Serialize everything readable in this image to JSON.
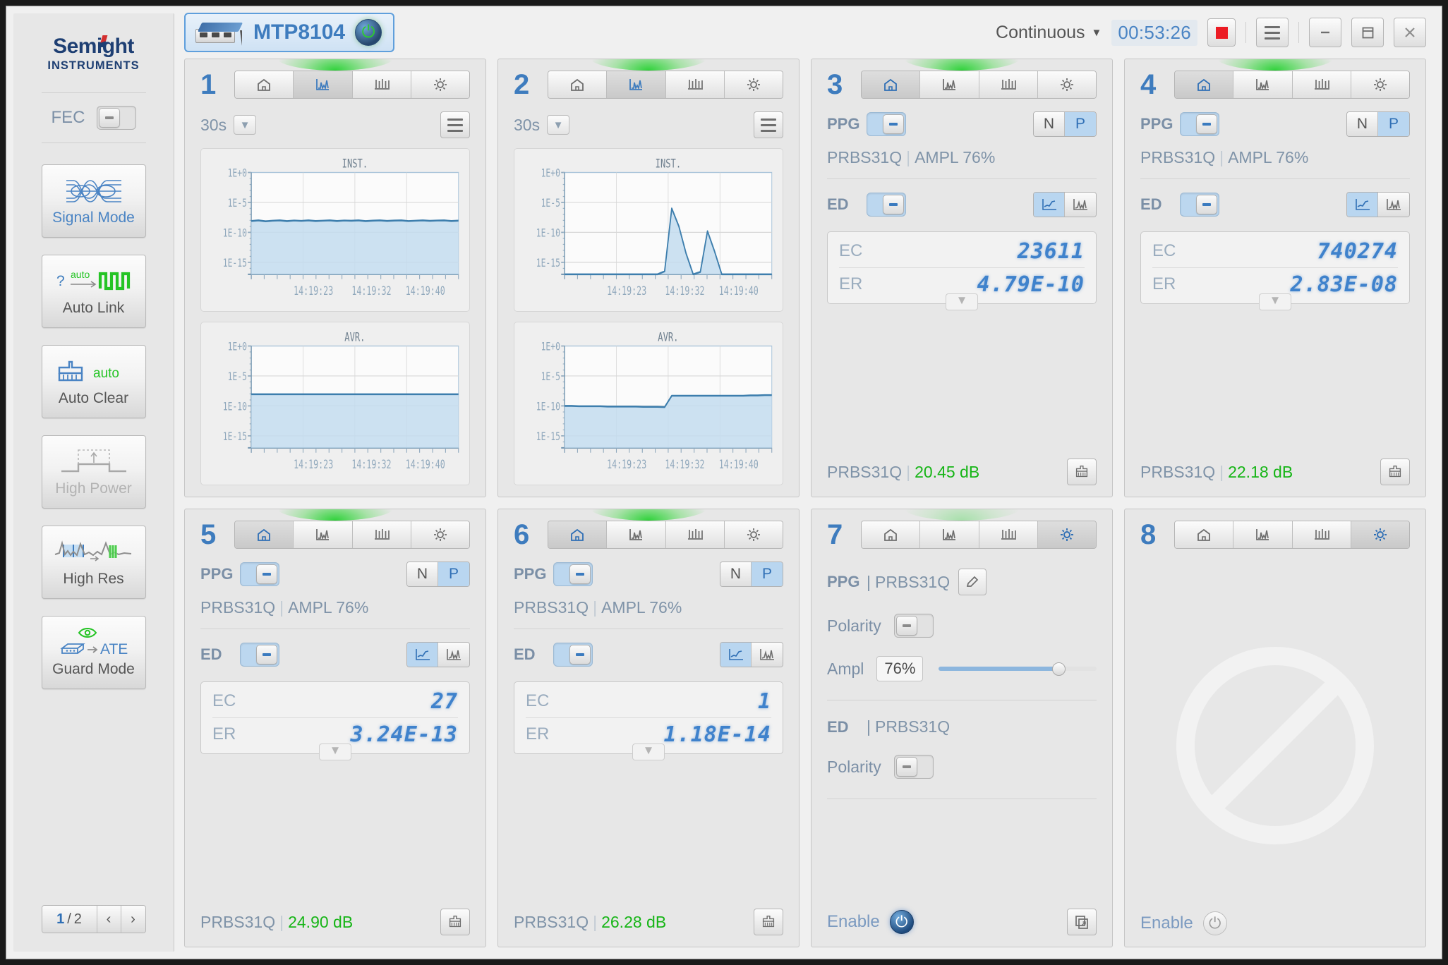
{
  "sidebar": {
    "logo_top": "Semight",
    "logo_bottom": "INSTRUMENTS",
    "fec_label": "FEC",
    "buttons": [
      {
        "label": "Signal Mode",
        "icon": "eye-diagram-icon",
        "state": "active"
      },
      {
        "label": "Auto Link",
        "icon": "auto-link-icon",
        "state": "normal",
        "badge": "auto",
        "q": "?"
      },
      {
        "label": "Auto Clear",
        "icon": "broom-icon",
        "state": "normal",
        "badge": "auto"
      },
      {
        "label": "High Power",
        "icon": "pulse-up-icon",
        "state": "disabled"
      },
      {
        "label": "High Res",
        "icon": "high-res-icon",
        "state": "normal"
      },
      {
        "label": "Guard Mode",
        "icon": "guard-ate-icon",
        "state": "normal",
        "badge": "ATE"
      }
    ],
    "pager": {
      "current": "1",
      "separator": "/",
      "total": "2",
      "prev": "‹",
      "next": "›"
    }
  },
  "topbar": {
    "device_name": "MTP8104",
    "power_icon": "power-icon",
    "mode": "Continuous",
    "mode_caret": "▼",
    "timer": "00:53:26",
    "stop_label": "stop-button",
    "menu_icon": "hamburger-icon",
    "minimize": "—",
    "restore": "restore-icon",
    "close": "✕"
  },
  "colors": {
    "accent_blue": "#3e7cbe",
    "lcd_blue": "#3f82cc",
    "green": "#17b517",
    "stop_red": "#ec1c24",
    "panel_bg": "#e7e7e7"
  },
  "panels": [
    {
      "num": "1",
      "type": "chart",
      "selected_tab": 1,
      "tabs": [
        "home-icon",
        "chart-icon",
        "histogram-icon",
        "gear-icon"
      ],
      "duration": "30s",
      "menu_icon": "list-icon",
      "charts": [
        {
          "title": "INST.",
          "series": "inst-1"
        },
        {
          "title": "AVR.",
          "series": "avr-1"
        }
      ]
    },
    {
      "num": "2",
      "type": "chart",
      "selected_tab": 1,
      "tabs": [
        "home-icon",
        "chart-icon",
        "histogram-icon",
        "gear-icon"
      ],
      "duration": "30s",
      "menu_icon": "list-icon",
      "charts": [
        {
          "title": "INST.",
          "series": "inst-2"
        },
        {
          "title": "AVR.",
          "series": "avr-2"
        }
      ]
    },
    {
      "num": "3",
      "type": "home",
      "selected_tab": 0,
      "tabs": [
        "home-icon",
        "chart-icon",
        "histogram-icon",
        "gear-icon"
      ],
      "ppg_label": "PPG",
      "ppg_on": true,
      "polarity": {
        "options": [
          "N",
          "P"
        ],
        "selected": "P"
      },
      "pattern": "PRBS31Q",
      "ampl": "AMPL 76%",
      "ed_label": "ED",
      "ed_on": true,
      "ed_view": {
        "options": [
          "trend-icon",
          "peak-icon"
        ],
        "selected": 0
      },
      "ec_label": "EC",
      "ec_value": "23611",
      "er_label": "ER",
      "er_value": "4.79E-10",
      "footer_pattern": "PRBS31Q",
      "footer_db": "20.45 dB",
      "clear_icon": "broom-icon"
    },
    {
      "num": "4",
      "type": "home",
      "selected_tab": 0,
      "tabs": [
        "home-icon",
        "chart-icon",
        "histogram-icon",
        "gear-icon"
      ],
      "ppg_label": "PPG",
      "ppg_on": true,
      "polarity": {
        "options": [
          "N",
          "P"
        ],
        "selected": "P"
      },
      "pattern": "PRBS31Q",
      "ampl": "AMPL 76%",
      "ed_label": "ED",
      "ed_on": true,
      "ed_view": {
        "options": [
          "trend-icon",
          "peak-icon"
        ],
        "selected": 0
      },
      "ec_label": "EC",
      "ec_value": "740274",
      "er_label": "ER",
      "er_value": "2.83E-08",
      "footer_pattern": "PRBS31Q",
      "footer_db": "22.18 dB",
      "clear_icon": "broom-icon"
    },
    {
      "num": "5",
      "type": "home",
      "selected_tab": 0,
      "tabs": [
        "home-icon",
        "chart-icon",
        "histogram-icon",
        "gear-icon"
      ],
      "ppg_label": "PPG",
      "ppg_on": true,
      "polarity": {
        "options": [
          "N",
          "P"
        ],
        "selected": "P"
      },
      "pattern": "PRBS31Q",
      "ampl": "AMPL 76%",
      "ed_label": "ED",
      "ed_on": true,
      "ed_view": {
        "options": [
          "trend-icon",
          "peak-icon"
        ],
        "selected": 0
      },
      "ec_label": "EC",
      "ec_value": "27",
      "er_label": "ER",
      "er_value": "3.24E-13",
      "footer_pattern": "PRBS31Q",
      "footer_db": "24.90 dB",
      "clear_icon": "broom-icon"
    },
    {
      "num": "6",
      "type": "home",
      "selected_tab": 0,
      "tabs": [
        "home-icon",
        "chart-icon",
        "histogram-icon",
        "gear-icon"
      ],
      "ppg_label": "PPG",
      "ppg_on": true,
      "polarity": {
        "options": [
          "N",
          "P"
        ],
        "selected": "P"
      },
      "pattern": "PRBS31Q",
      "ampl": "AMPL 76%",
      "ed_label": "ED",
      "ed_on": true,
      "ed_view": {
        "options": [
          "trend-icon",
          "peak-icon"
        ],
        "selected": 0
      },
      "ec_label": "EC",
      "ec_value": "1",
      "er_label": "ER",
      "er_value": "1.18E-14",
      "footer_pattern": "PRBS31Q",
      "footer_db": "26.28 dB",
      "clear_icon": "broom-icon"
    },
    {
      "num": "7",
      "type": "settings",
      "selected_tab": 3,
      "tabs": [
        "home-icon",
        "chart-icon",
        "histogram-icon",
        "gear-icon"
      ],
      "ppg_label": "PPG",
      "ppg_pattern": "PRBS31Q",
      "edit_icon": "pencil-icon",
      "ppg_polarity_label": "Polarity",
      "ampl_label": "Ampl",
      "ampl_value": "76%",
      "ampl_percent": 76,
      "ed_label": "ED",
      "ed_pattern": "PRBS31Q",
      "ed_polarity_label": "Polarity",
      "enable_label": "Enable",
      "enabled": true,
      "copy_icon": "copy-icon"
    },
    {
      "num": "8",
      "type": "disabled",
      "selected_tab": 3,
      "tabs": [
        "home-icon",
        "chart-icon",
        "histogram-icon",
        "gear-icon"
      ],
      "disabled_icon": "no-entry-icon",
      "enable_label": "Enable",
      "enabled": false
    }
  ],
  "chart_data": [
    {
      "id": "inst-1",
      "type": "line",
      "title": "INST.",
      "ylabel": "",
      "xlabel": "",
      "yticks": [
        "1E+0",
        "1E-5",
        "1E-10",
        "1E-15"
      ],
      "ylim": [
        -17,
        0
      ],
      "grid": true,
      "xticks": [
        "14:19:23",
        "14:19:32",
        "14:19:40"
      ],
      "values": [
        -8.1,
        -8.0,
        -8.15,
        -8.05,
        -8.0,
        -8.12,
        -8.02,
        -8.08,
        -8.0,
        -8.1,
        -8.05,
        -8.0,
        -8.1,
        -8.02,
        -8.06,
        -8.0,
        -8.12,
        -8.04,
        -8.0,
        -8.09,
        -8.03,
        -8.0,
        -8.11,
        -8.05,
        -8.0,
        -8.07,
        -8.02,
        -8.0,
        -8.1,
        -8.04
      ]
    },
    {
      "id": "avr-1",
      "type": "line",
      "title": "AVR.",
      "yticks": [
        "1E+0",
        "1E-5",
        "1E-10",
        "1E-15"
      ],
      "ylim": [
        -17,
        0
      ],
      "grid": true,
      "xticks": [
        "14:19:23",
        "14:19:32",
        "14:19:40"
      ],
      "values": [
        -8.05,
        -8.05,
        -8.05,
        -8.05,
        -8.05,
        -8.05,
        -8.05,
        -8.05,
        -8.05,
        -8.05,
        -8.05,
        -8.05,
        -8.05,
        -8.05,
        -8.05,
        -8.05,
        -8.05,
        -8.05,
        -8.05,
        -8.05,
        -8.05,
        -8.05,
        -8.05,
        -8.05,
        -8.05,
        -8.05,
        -8.05,
        -8.05,
        -8.05,
        -8.05
      ]
    },
    {
      "id": "inst-2",
      "type": "line",
      "title": "INST.",
      "yticks": [
        "1E+0",
        "1E-5",
        "1E-10",
        "1E-15"
      ],
      "ylim": [
        -17,
        0
      ],
      "grid": true,
      "xticks": [
        "14:19:23",
        "14:19:32",
        "14:19:40"
      ],
      "values": [
        -17,
        -17,
        -17,
        -17,
        -17,
        -17,
        -17,
        -17,
        -17,
        -17,
        -17,
        -17,
        -17,
        -17,
        -16.5,
        -6.0,
        -9.0,
        -13.5,
        -17,
        -16.6,
        -9.8,
        -13.2,
        -17,
        -17,
        -17,
        -17,
        -17,
        -17,
        -17,
        -17
      ]
    },
    {
      "id": "avr-2",
      "type": "line",
      "title": "AVR.",
      "yticks": [
        "1E+0",
        "1E-5",
        "1E-10",
        "1E-15"
      ],
      "ylim": [
        -17,
        0
      ],
      "grid": true,
      "xticks": [
        "14:19:23",
        "14:19:32",
        "14:19:40"
      ],
      "values": [
        -10.0,
        -10.0,
        -10.05,
        -10.05,
        -10.05,
        -10.05,
        -10.1,
        -10.1,
        -10.1,
        -10.1,
        -10.1,
        -10.15,
        -10.15,
        -10.15,
        -10.2,
        -8.3,
        -8.3,
        -8.3,
        -8.3,
        -8.3,
        -8.3,
        -8.3,
        -8.3,
        -8.3,
        -8.3,
        -8.3,
        -8.25,
        -8.25,
        -8.2,
        -8.2
      ]
    }
  ]
}
